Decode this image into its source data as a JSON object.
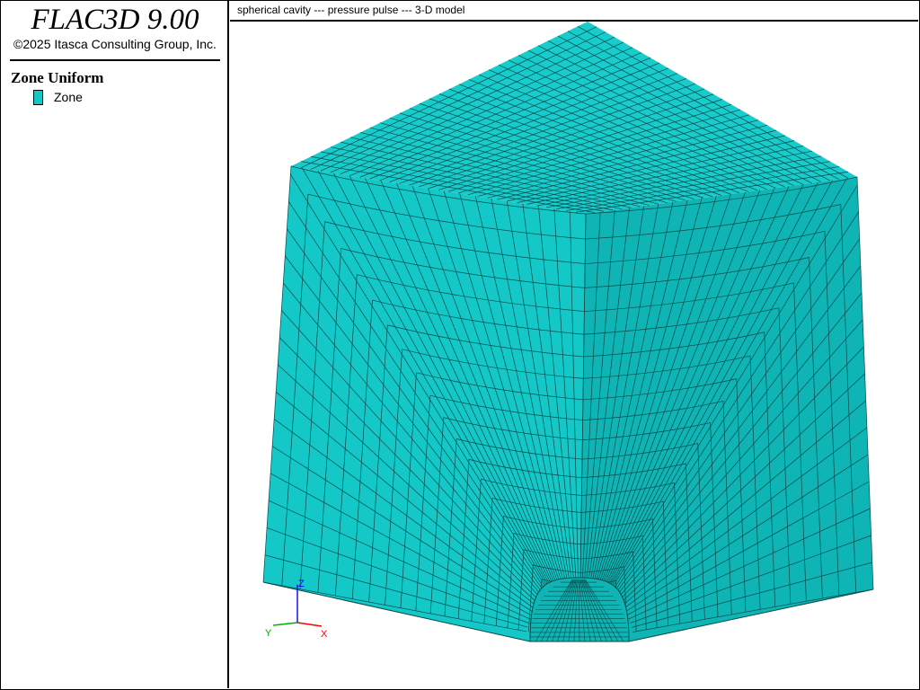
{
  "app": {
    "title": "FLAC3D 9.00",
    "copyright": "©2025 Itasca Consulting Group, Inc."
  },
  "legend": {
    "title": "Zone Uniform",
    "items": [
      {
        "label": "Zone",
        "color": "#14c8c8"
      }
    ]
  },
  "viewport": {
    "caption": "spherical cavity --- pressure pulse --- 3-D model",
    "colors": {
      "zone_fill": "#14c8c8",
      "zone_fill_top": "#18cccc",
      "zone_fill_dark": "#0fb4b4",
      "mesh_line": "#0a4a4a",
      "axis_x": "#ff0000",
      "axis_y": "#00b000",
      "axis_z": "#0000ff"
    },
    "axes": {
      "x_label": "X",
      "y_label": "Y",
      "z_label": "Z"
    }
  }
}
